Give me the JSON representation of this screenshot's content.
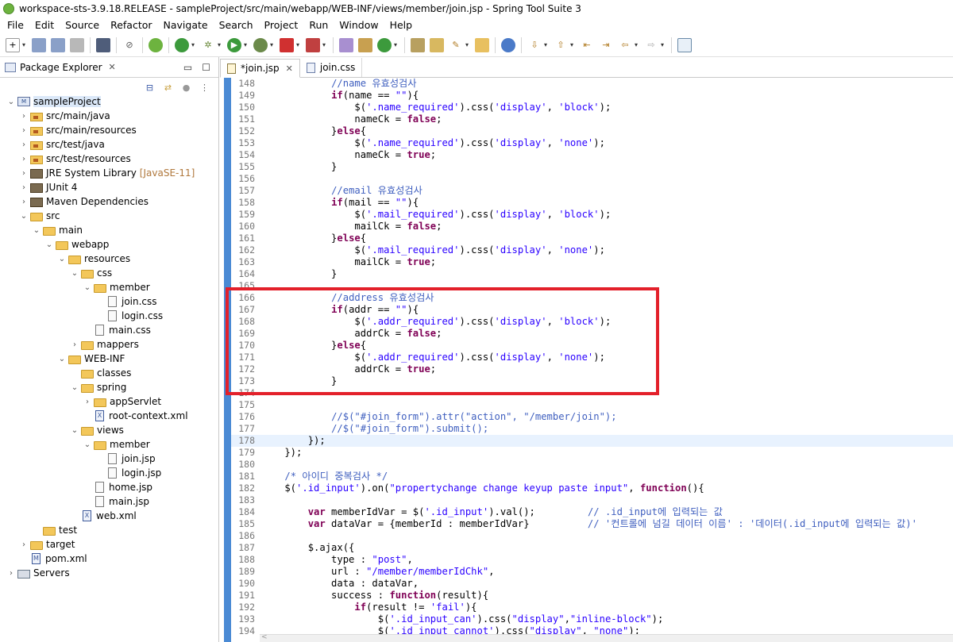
{
  "window": {
    "title": "workspace-sts-3.9.18.RELEASE - sampleProject/src/main/webapp/WEB-INF/views/member/join.jsp - Spring Tool Suite 3"
  },
  "menu": [
    "File",
    "Edit",
    "Source",
    "Refactor",
    "Navigate",
    "Search",
    "Project",
    "Run",
    "Window",
    "Help"
  ],
  "left_panel": {
    "tab_label": "Package Explorer",
    "tree": [
      {
        "label": "sampleProject",
        "depth": 0,
        "expanded": true,
        "icon": "project-icon",
        "selected": true
      },
      {
        "label": "src/main/java",
        "depth": 1,
        "expanded": false,
        "icon": "package-folder-icon"
      },
      {
        "label": "src/main/resources",
        "depth": 1,
        "expanded": false,
        "icon": "package-folder-icon"
      },
      {
        "label": "src/test/java",
        "depth": 1,
        "expanded": false,
        "icon": "package-folder-icon"
      },
      {
        "label": "src/test/resources",
        "depth": 1,
        "expanded": false,
        "icon": "package-folder-icon"
      },
      {
        "label": "JRE System Library",
        "decoration": "[JavaSE-11]",
        "depth": 1,
        "expanded": false,
        "icon": "library-icon"
      },
      {
        "label": "JUnit 4",
        "depth": 1,
        "expanded": false,
        "icon": "library-icon"
      },
      {
        "label": "Maven Dependencies",
        "depth": 1,
        "expanded": false,
        "icon": "library-icon"
      },
      {
        "label": "src",
        "depth": 1,
        "expanded": true,
        "icon": "folder-icon"
      },
      {
        "label": "main",
        "depth": 2,
        "expanded": true,
        "icon": "folder-icon"
      },
      {
        "label": "webapp",
        "depth": 3,
        "expanded": true,
        "icon": "folder-icon"
      },
      {
        "label": "resources",
        "depth": 4,
        "expanded": true,
        "icon": "folder-icon"
      },
      {
        "label": "css",
        "depth": 5,
        "expanded": true,
        "icon": "folder-icon"
      },
      {
        "label": "member",
        "depth": 6,
        "expanded": true,
        "icon": "folder-icon"
      },
      {
        "label": "join.css",
        "depth": 7,
        "leaf": true,
        "icon": "file-icon"
      },
      {
        "label": "login.css",
        "depth": 7,
        "leaf": true,
        "icon": "file-icon"
      },
      {
        "label": "main.css",
        "depth": 6,
        "leaf": true,
        "icon": "file-icon"
      },
      {
        "label": "mappers",
        "depth": 5,
        "expanded": false,
        "icon": "folder-icon"
      },
      {
        "label": "WEB-INF",
        "depth": 4,
        "expanded": true,
        "icon": "folder-icon"
      },
      {
        "label": "classes",
        "depth": 5,
        "leaf": true,
        "icon": "folder-icon"
      },
      {
        "label": "spring",
        "depth": 5,
        "expanded": true,
        "icon": "folder-icon"
      },
      {
        "label": "appServlet",
        "depth": 6,
        "expanded": false,
        "icon": "folder-icon"
      },
      {
        "label": "root-context.xml",
        "depth": 6,
        "leaf": true,
        "icon": "xml-file-icon"
      },
      {
        "label": "views",
        "depth": 5,
        "expanded": true,
        "icon": "folder-icon"
      },
      {
        "label": "member",
        "depth": 6,
        "expanded": true,
        "icon": "folder-icon"
      },
      {
        "label": "join.jsp",
        "depth": 7,
        "leaf": true,
        "icon": "file-icon"
      },
      {
        "label": "login.jsp",
        "depth": 7,
        "leaf": true,
        "icon": "file-icon"
      },
      {
        "label": "home.jsp",
        "depth": 6,
        "leaf": true,
        "icon": "file-icon"
      },
      {
        "label": "main.jsp",
        "depth": 6,
        "leaf": true,
        "icon": "file-icon"
      },
      {
        "label": "web.xml",
        "depth": 5,
        "leaf": true,
        "icon": "xml-file-icon"
      },
      {
        "label": "test",
        "depth": 2,
        "leaf": true,
        "icon": "folder-icon"
      },
      {
        "label": "target",
        "depth": 1,
        "expanded": false,
        "icon": "folder-icon"
      },
      {
        "label": "pom.xml",
        "depth": 1,
        "leaf": true,
        "icon": "maven-file-icon"
      },
      {
        "label": "Servers",
        "depth": 0,
        "expanded": false,
        "icon": "server-folder-icon"
      }
    ]
  },
  "editor": {
    "tabs": [
      {
        "label": "*join.jsp",
        "active": true,
        "icon": "jsp-file-icon",
        "closable": true
      },
      {
        "label": "join.css",
        "active": false,
        "icon": "css-file-icon"
      }
    ],
    "current_line": 178,
    "lines": [
      {
        "n": 148,
        "t": "            //name 유효성검사"
      },
      {
        "n": 149,
        "t": "            if(name == \"\"){"
      },
      {
        "n": 150,
        "t": "                $('.name_required').css('display', 'block');"
      },
      {
        "n": 151,
        "t": "                nameCk = false;"
      },
      {
        "n": 152,
        "t": "            }else{"
      },
      {
        "n": 153,
        "t": "                $('.name_required').css('display', 'none');"
      },
      {
        "n": 154,
        "t": "                nameCk = true;"
      },
      {
        "n": 155,
        "t": "            }"
      },
      {
        "n": 156,
        "t": ""
      },
      {
        "n": 157,
        "t": "            //email 유효성검사"
      },
      {
        "n": 158,
        "t": "            if(mail == \"\"){"
      },
      {
        "n": 159,
        "t": "                $('.mail_required').css('display', 'block');"
      },
      {
        "n": 160,
        "t": "                mailCk = false;"
      },
      {
        "n": 161,
        "t": "            }else{"
      },
      {
        "n": 162,
        "t": "                $('.mail_required').css('display', 'none');"
      },
      {
        "n": 163,
        "t": "                mailCk = true;"
      },
      {
        "n": 164,
        "t": "            }"
      },
      {
        "n": 165,
        "t": ""
      },
      {
        "n": 166,
        "t": "            //address 유효성검사"
      },
      {
        "n": 167,
        "t": "            if(addr == \"\"){"
      },
      {
        "n": 168,
        "t": "                $('.addr_required').css('display', 'block');"
      },
      {
        "n": 169,
        "t": "                addrCk = false;"
      },
      {
        "n": 170,
        "t": "            }else{"
      },
      {
        "n": 171,
        "t": "                $('.addr_required').css('display', 'none');"
      },
      {
        "n": 172,
        "t": "                addrCk = true;"
      },
      {
        "n": 173,
        "t": "            }"
      },
      {
        "n": 174,
        "t": ""
      },
      {
        "n": 175,
        "t": ""
      },
      {
        "n": 176,
        "t": "            //$(\"#join_form\").attr(\"action\", \"/member/join\");"
      },
      {
        "n": 177,
        "t": "            //$(\"#join_form\").submit();"
      },
      {
        "n": 178,
        "t": "        });"
      },
      {
        "n": 179,
        "t": "    });"
      },
      {
        "n": 180,
        "t": ""
      },
      {
        "n": 181,
        "t": "    /* 아이디 중복검사 */"
      },
      {
        "n": 182,
        "t": "    $('.id_input').on(\"propertychange change keyup paste input\", function(){"
      },
      {
        "n": 183,
        "t": ""
      },
      {
        "n": 184,
        "t": "        var memberIdVar = $('.id_input').val();         // .id_input에 입력되는 값"
      },
      {
        "n": 185,
        "t": "        var dataVar = {memberId : memberIdVar}          // '컨트롤에 넘길 데이터 이름' : '데이터(.id_input에 입력되는 값)'"
      },
      {
        "n": 186,
        "t": ""
      },
      {
        "n": 187,
        "t": "        $.ajax({"
      },
      {
        "n": 188,
        "t": "            type : \"post\","
      },
      {
        "n": 189,
        "t": "            url : \"/member/memberIdChk\","
      },
      {
        "n": 190,
        "t": "            data : dataVar,"
      },
      {
        "n": 191,
        "t": "            success : function(result){"
      },
      {
        "n": 192,
        "t": "                if(result != 'fail'){"
      },
      {
        "n": 193,
        "t": "                    $('.id_input_can').css(\"display\",\"inline-block\");"
      },
      {
        "n": 194,
        "t": "                    $('.id_input_cannot').css(\"display\", \"none\");"
      }
    ]
  }
}
